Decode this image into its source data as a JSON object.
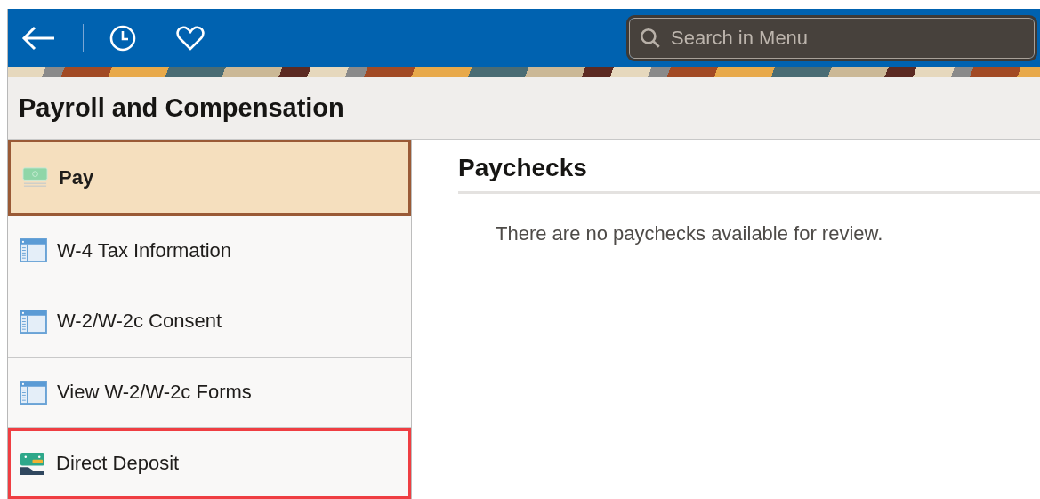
{
  "header": {
    "search": {
      "placeholder": "Search in Menu"
    }
  },
  "page_title": "Payroll and Compensation",
  "sidebar": {
    "items": [
      {
        "label": "Pay",
        "kind": "cash",
        "selected": true,
        "highlighted": false
      },
      {
        "label": "W-4 Tax Information",
        "kind": "form",
        "selected": false,
        "highlighted": false
      },
      {
        "label": "W-2/W-2c Consent",
        "kind": "form",
        "selected": false,
        "highlighted": false
      },
      {
        "label": "View W-2/W-2c Forms",
        "kind": "form",
        "selected": false,
        "highlighted": false
      },
      {
        "label": "Direct Deposit",
        "kind": "deposit",
        "selected": false,
        "highlighted": true
      }
    ]
  },
  "content": {
    "heading": "Paychecks",
    "message": "There are no paychecks available for review."
  }
}
